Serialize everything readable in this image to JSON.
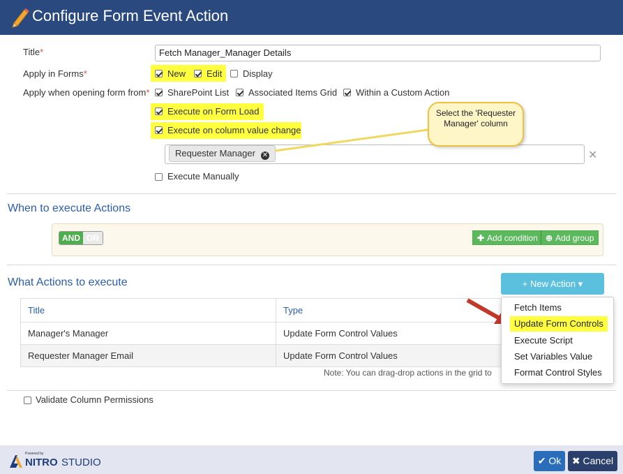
{
  "dialog": {
    "title": "Configure Form Event Action"
  },
  "form": {
    "title_label": "Title",
    "title_value": "Fetch Manager_Manager Details",
    "apply_in_forms_label": "Apply in Forms",
    "forms": [
      {
        "label": "New",
        "checked": true
      },
      {
        "label": "Edit",
        "checked": true
      },
      {
        "label": "Display",
        "checked": false
      }
    ],
    "opening_from_label": "Apply when opening form from",
    "sources": [
      {
        "label": "SharePoint List",
        "checked": true
      },
      {
        "label": "Associated Items Grid",
        "checked": true
      },
      {
        "label": "Within a Custom Action",
        "checked": true
      }
    ],
    "execute_on_form_load": {
      "label": "Execute on Form Load",
      "checked": true
    },
    "execute_on_column_change": {
      "label": "Execute on column value change",
      "checked": true
    },
    "column_tag": "Requester Manager",
    "execute_manually": {
      "label": "Execute Manually",
      "checked": false
    },
    "callout": "Select the 'Requester Manager' column"
  },
  "conditions": {
    "section_title": "When to execute Actions",
    "and_label": "AND",
    "or_label": "OR",
    "add_condition_label": "Add condition",
    "add_group_label": "Add group"
  },
  "actions": {
    "section_title": "What Actions to execute",
    "new_action_label": "New Action",
    "columns": [
      "Title",
      "Type"
    ],
    "rows": [
      {
        "title": "Manager's Manager",
        "type": "Update Form Control Values"
      },
      {
        "title": "Requester Manager Email",
        "type": "Update Form Control Values"
      }
    ],
    "note": "Note: You can drag-drop actions in the grid to",
    "menu": [
      "Fetch Items",
      "Update Form Controls",
      "Execute Script",
      "Set Variables Value",
      "Format Control Styles"
    ]
  },
  "validate": {
    "label": "Validate Column Permissions",
    "checked": false
  },
  "footer": {
    "powered_by": "Powered by",
    "brand_nitro": "NITRO",
    "brand_studio": "STUDIO",
    "ok_label": "Ok",
    "cancel_label": "Cancel"
  },
  "colors": {
    "header": "#2a4a7f",
    "highlight": "#ffff40",
    "accent": "#5bc0de",
    "success": "#5cb85c"
  }
}
